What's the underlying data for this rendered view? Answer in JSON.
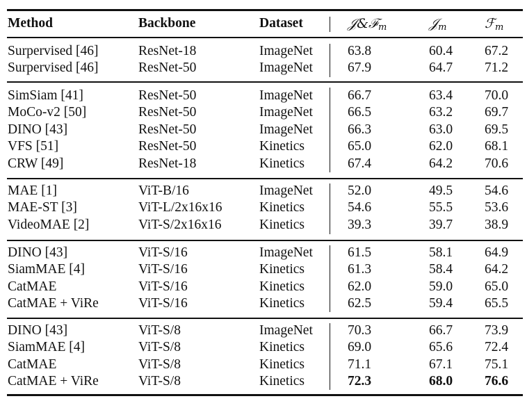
{
  "table": {
    "headers": {
      "method": "Method",
      "backbone": "Backbone",
      "dataset": "Dataset",
      "jf_main": "𝒥&ℱ",
      "jf_sub": "m",
      "j_main": "𝒥",
      "j_sub": "m",
      "f_main": "ℱ",
      "f_sub": "m"
    },
    "groups": [
      {
        "rows": [
          {
            "method": "Surpervised [46]",
            "backbone": "ResNet-18",
            "dataset": "ImageNet",
            "jf": "63.8",
            "j": "60.4",
            "f": "67.2"
          },
          {
            "method": "Surpervised [46]",
            "backbone": "ResNet-50",
            "dataset": "ImageNet",
            "jf": "67.9",
            "j": "64.7",
            "f": "71.2"
          }
        ]
      },
      {
        "rows": [
          {
            "method": "SimSiam [41]",
            "backbone": "ResNet-50",
            "dataset": "ImageNet",
            "jf": "66.7",
            "j": "63.4",
            "f": "70.0"
          },
          {
            "method": "MoCo-v2 [50]",
            "backbone": "ResNet-50",
            "dataset": "ImageNet",
            "jf": "66.5",
            "j": "63.2",
            "f": "69.7"
          },
          {
            "method": "DINO [43]",
            "backbone": "ResNet-50",
            "dataset": "ImageNet",
            "jf": "66.3",
            "j": "63.0",
            "f": "69.5"
          },
          {
            "method": "VFS [51]",
            "backbone": "ResNet-50",
            "dataset": "Kinetics",
            "jf": "65.0",
            "j": "62.0",
            "f": "68.1"
          },
          {
            "method": "CRW [49]",
            "backbone": "ResNet-18",
            "dataset": "Kinetics",
            "jf": "67.4",
            "j": "64.2",
            "f": "70.6"
          }
        ]
      },
      {
        "rows": [
          {
            "method": "MAE [1]",
            "backbone": "ViT-B/16",
            "dataset": "ImageNet",
            "jf": "52.0",
            "j": "49.5",
            "f": "54.6"
          },
          {
            "method": "MAE-ST [3]",
            "backbone": "ViT-L/2x16x16",
            "dataset": "Kinetics",
            "jf": "54.6",
            "j": "55.5",
            "f": "53.6"
          },
          {
            "method": "VideoMAE [2]",
            "backbone": "ViT-S/2x16x16",
            "dataset": "Kinetics",
            "jf": "39.3",
            "j": "39.7",
            "f": "38.9"
          }
        ]
      },
      {
        "rows": [
          {
            "method": "DINO [43]",
            "backbone": "ViT-S/16",
            "dataset": "ImageNet",
            "jf": "61.5",
            "j": "58.1",
            "f": "64.9"
          },
          {
            "method": "SiamMAE [4]",
            "backbone": "ViT-S/16",
            "dataset": "Kinetics",
            "jf": "61.3",
            "j": "58.4",
            "f": "64.2"
          },
          {
            "method": "CatMAE",
            "backbone": "ViT-S/16",
            "dataset": "Kinetics",
            "jf": "62.0",
            "j": "59.0",
            "f": "65.0"
          },
          {
            "method": "CatMAE + ViRe",
            "backbone": "ViT-S/16",
            "dataset": "Kinetics",
            "jf": "62.5",
            "j": "59.4",
            "f": "65.5"
          }
        ]
      },
      {
        "rows": [
          {
            "method": "DINO [43]",
            "backbone": "ViT-S/8",
            "dataset": "ImageNet",
            "jf": "70.3",
            "j": "66.7",
            "f": "73.9"
          },
          {
            "method": "SiamMAE [4]",
            "backbone": "ViT-S/8",
            "dataset": "Kinetics",
            "jf": "69.0",
            "j": "65.6",
            "f": "72.4"
          },
          {
            "method": "CatMAE",
            "backbone": "ViT-S/8",
            "dataset": "Kinetics",
            "jf": "71.1",
            "j": "67.1",
            "f": "75.1"
          },
          {
            "method": "CatMAE + ViRe",
            "backbone": "ViT-S/8",
            "dataset": "Kinetics",
            "jf": "72.3",
            "j": "68.0",
            "f": "76.6",
            "bold_metrics": true
          }
        ]
      }
    ]
  }
}
